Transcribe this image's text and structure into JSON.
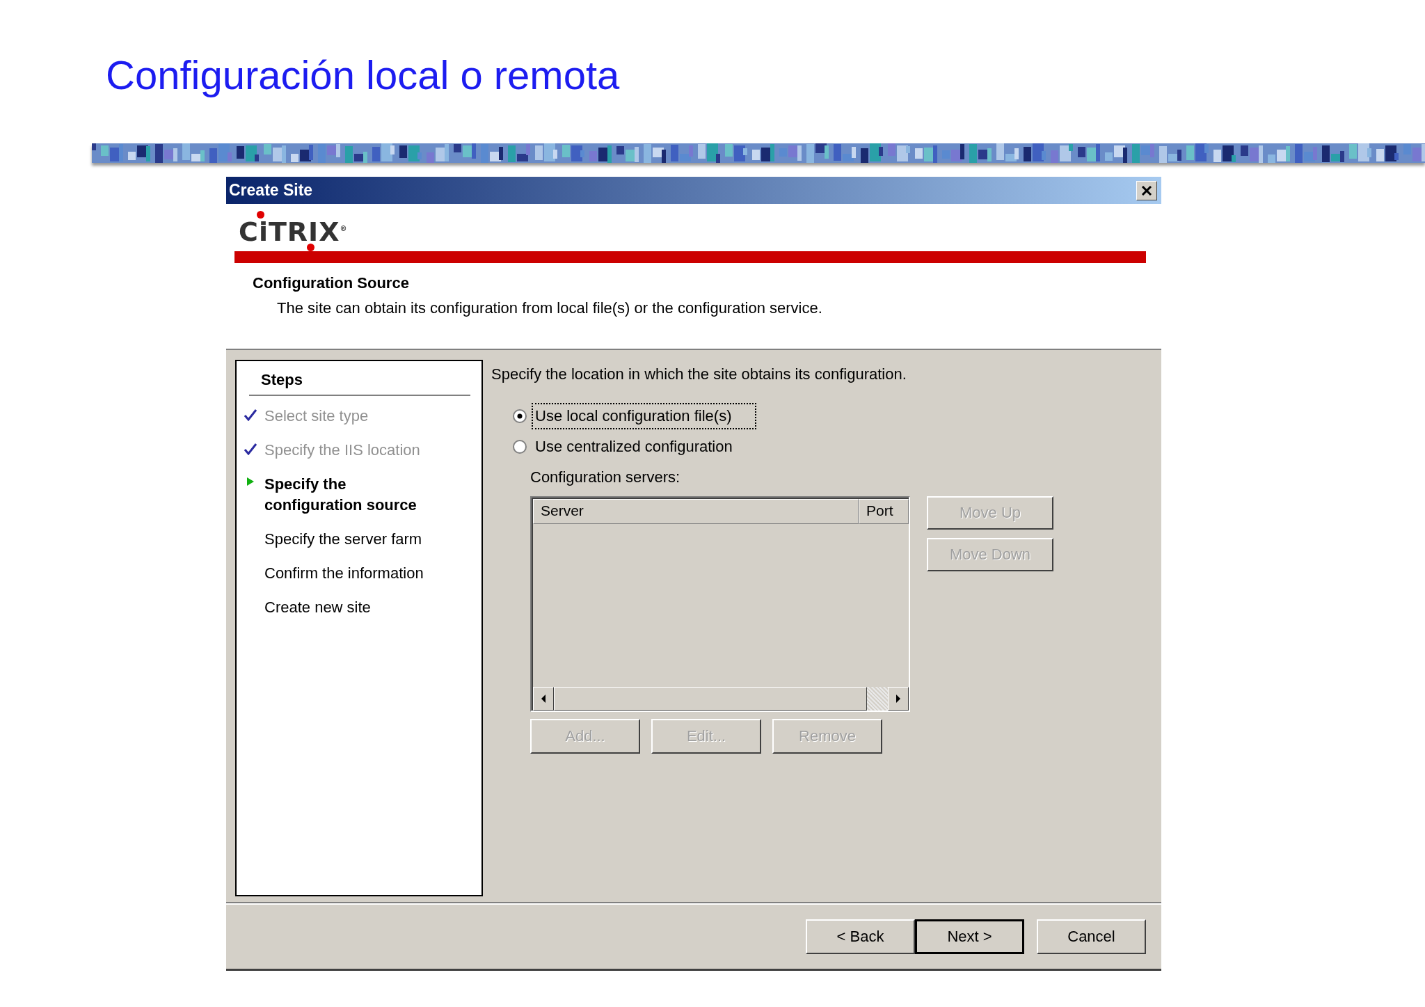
{
  "slide_title": "Configuración local o remota",
  "window": {
    "title": "Create Site"
  },
  "logo": "CiTRIX$^{®}$",
  "header": {
    "title": "Configuration Source",
    "description": "The site can obtain its configuration from local file(s) or the configuration service."
  },
  "steps": {
    "title": "Steps",
    "items": [
      {
        "label": "Select site type",
        "kind": "done"
      },
      {
        "label": "Specify the IIS location",
        "kind": "done"
      },
      {
        "label": "Specify the configuration source",
        "kind": "current"
      },
      {
        "label": "Specify the server farm",
        "kind": "pending"
      },
      {
        "label": "Confirm the information",
        "kind": "pending"
      },
      {
        "label": "Create new site",
        "kind": "pending"
      }
    ]
  },
  "instruction": "Specify the location in which the site obtains its configuration.",
  "options": [
    {
      "label": "Use local configuration file(s)",
      "selected": true,
      "focused": true
    },
    {
      "label": "Use centralized configuration",
      "selected": false,
      "focused": false
    }
  ],
  "servers": {
    "label": "Configuration servers:",
    "columns": [
      "Server",
      "Port"
    ]
  },
  "side_buttons": [
    {
      "label": "Move Up",
      "disabled": true
    },
    {
      "label": "Move Down",
      "disabled": true
    }
  ],
  "list_buttons": [
    {
      "label": "Add...",
      "disabled": true
    },
    {
      "label": "Edit...",
      "disabled": true
    },
    {
      "label": "Remove",
      "disabled": true
    }
  ],
  "footer_buttons": [
    {
      "label": "< Back",
      "default": false
    },
    {
      "label": "Next >",
      "default": true
    },
    {
      "label": "Cancel",
      "default": false
    }
  ]
}
